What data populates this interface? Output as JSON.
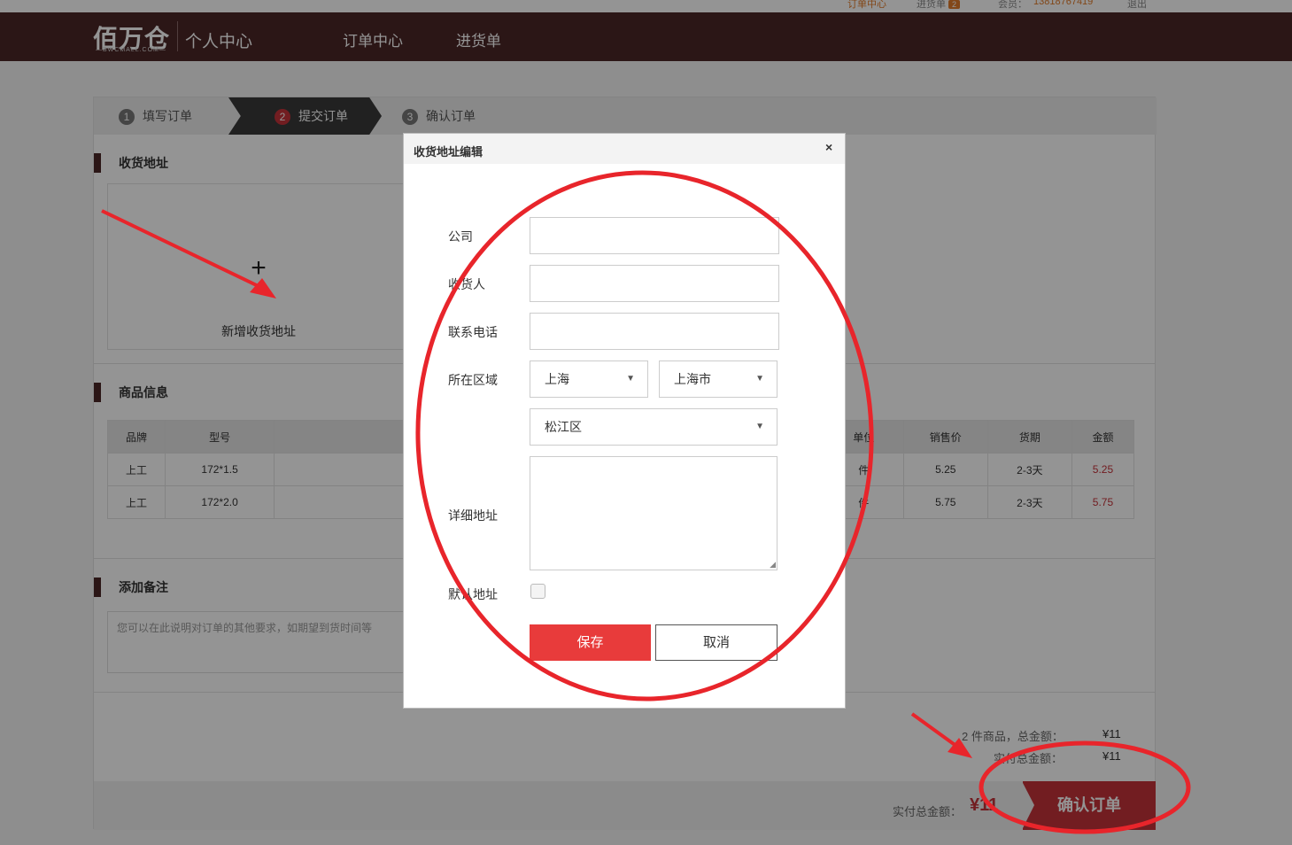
{
  "topbar": {
    "orders_link": "订单中心",
    "cart_label": "进货单",
    "cart_count": "2",
    "member_label": "会员：",
    "member_phone": "13818767419",
    "logout": "退出"
  },
  "header": {
    "logo": "佰万仓",
    "logo_sub": "—BWCMALL.COM—",
    "title": "个人中心",
    "nav": [
      "订单中心",
      "进货单"
    ]
  },
  "steps": [
    {
      "num": "1",
      "label": "填写订单"
    },
    {
      "num": "2",
      "label": "提交订单"
    },
    {
      "num": "3",
      "label": "确认订单"
    }
  ],
  "address": {
    "section_title": "收货地址",
    "add_icon": "plus-icon",
    "add_label": "新增收货地址"
  },
  "goods": {
    "section_title": "商品信息",
    "columns": [
      "品牌",
      "型号",
      "单位",
      "销售价",
      "货期",
      "金额"
    ],
    "rows": [
      {
        "brand": "上工",
        "model": "172*1.5",
        "unit": "件",
        "price": "5.25",
        "lead": "2-3天",
        "amount": "5.25"
      },
      {
        "brand": "上工",
        "model": "172*2.0",
        "unit": "件",
        "price": "5.75",
        "lead": "2-3天",
        "amount": "5.75"
      }
    ]
  },
  "remark": {
    "section_title": "添加备注",
    "placeholder": "您可以在此说明对订单的其他要求，如期望到货时间等"
  },
  "summary": {
    "count_label": "2 件商品，总金额：",
    "count_value": "¥11",
    "paid_label": "实付总金额：",
    "paid_value": "¥11",
    "bottom_label": "实付总金额：",
    "bottom_value": "¥11",
    "confirm": "确认订单"
  },
  "dialog": {
    "title": "收货地址编辑",
    "close": "×",
    "company_label": "公司",
    "receiver_label": "收货人",
    "phone_label": "联系电话",
    "region_label": "所在区域",
    "province": "上海",
    "city": "上海市",
    "district": "松江区",
    "detail_label": "详细地址",
    "default_label": "默认地址",
    "save": "保存",
    "cancel": "取消"
  },
  "colors": {
    "header_bg": "#4b2627",
    "accent_red": "#c4323a",
    "save_btn": "#e83b3b",
    "annotation": "#e8252b"
  }
}
